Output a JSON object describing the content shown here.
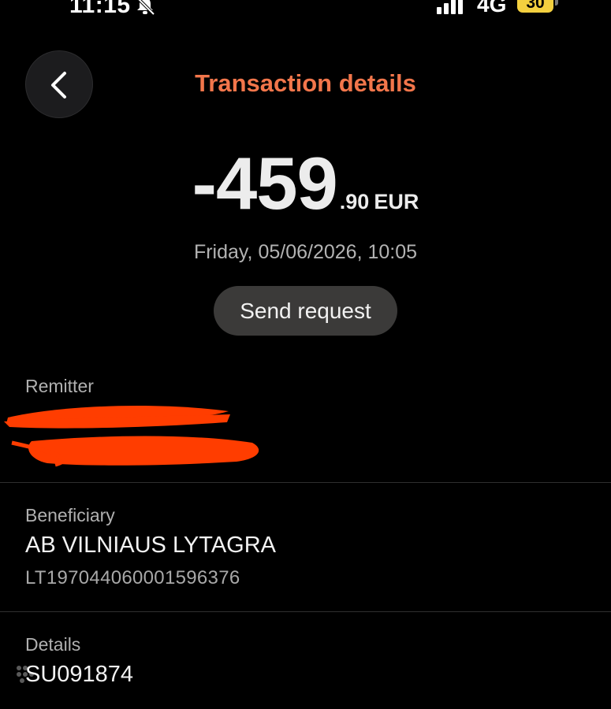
{
  "status_bar": {
    "time": "11:15",
    "network": "4G",
    "battery_level": "30"
  },
  "header": {
    "title": "Transaction details",
    "back_icon": "chevron-left-icon"
  },
  "amount": {
    "main": "-459",
    "cents": ".90",
    "currency": "EUR"
  },
  "date": "Friday, 05/06/2026, 10:05",
  "actions": {
    "send_request_label": "Send request"
  },
  "remitter": {
    "label": "Remitter",
    "name_redacted": true,
    "account_redacted": true
  },
  "beneficiary": {
    "label": "Beneficiary",
    "name": "AB VILNIAUS LYTAGRA",
    "account": "LT197044060001596376"
  },
  "details": {
    "label": "Details",
    "value": "SU091874"
  },
  "colors": {
    "background": "#000000",
    "title_accent": "#f2764b",
    "redaction": "#ff3d00",
    "battery": "#f4d03f"
  }
}
